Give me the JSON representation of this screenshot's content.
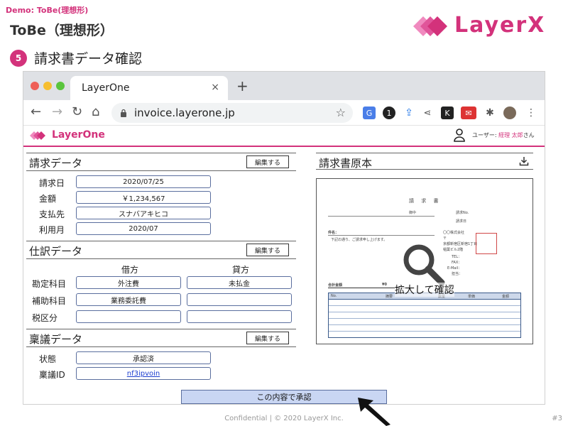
{
  "slide": {
    "demo_tag": "Demo: ToBe(理想形)",
    "title": "ToBe（理想形）",
    "logo_text": "LayerX",
    "step_number": "5",
    "step_title": "請求書データ確認",
    "footer": "Confidential | © 2020 LayerX Inc.",
    "page_number": "#3",
    "accent_color": "#d3327b"
  },
  "browser": {
    "tab_title": "LayerOne",
    "tab_close": "×",
    "new_tab": "+",
    "url": "invoice.layerone.jp",
    "nav": {
      "back": "←",
      "forward": "→",
      "reload": "↻",
      "home": "⌂"
    },
    "extensions": [
      "translate-icon",
      "1password-icon",
      "share-ext-icon",
      "share-icon",
      "k-icon",
      "gmail-badge-icon",
      "puzzle-icon",
      "avatar-icon",
      "menu-icon"
    ]
  },
  "app": {
    "name": "LayerOne",
    "user_label": "ユーザー: ",
    "user_name": "経理 太郎",
    "user_suffix": "さん"
  },
  "invoice_data": {
    "title": "請求データ",
    "edit_label": "編集する",
    "fields": [
      {
        "label": "請求日",
        "value": "2020/07/25"
      },
      {
        "label": "金額",
        "value": "￥1,234,567"
      },
      {
        "label": "支払先",
        "value": "スナバアキヒコ"
      },
      {
        "label": "利用月",
        "value": "2020/07"
      }
    ]
  },
  "journal": {
    "title": "仕訳データ",
    "edit_label": "編集する",
    "debit_header": "借方",
    "credit_header": "貸方",
    "rows": [
      {
        "label": "勘定科目",
        "debit": "外注費",
        "credit": "未払金"
      },
      {
        "label": "補助科目",
        "debit": "業務委託費",
        "credit": ""
      },
      {
        "label": "税区分",
        "debit": "",
        "credit": ""
      }
    ]
  },
  "approval": {
    "title": "稟議データ",
    "edit_label": "編集する",
    "fields": [
      {
        "label": "状態",
        "value": "承認済"
      },
      {
        "label": "稟議ID",
        "value": "nf3ipvoin"
      }
    ]
  },
  "original": {
    "title": "請求書原本",
    "zoom_label": "拡大して確認",
    "doc": {
      "heading": "請 求 書",
      "to_suffix": "御中",
      "invoice_no": "請求No.",
      "issue_date": "請求日",
      "subject_label": "件名：",
      "greeting": "下記の通り、ご請求申し上げます。",
      "company": "〇〇株式会社",
      "postal": "〒",
      "address1": "京都新宿区新宿1丁目",
      "address2": "稲葉ビル2階",
      "tel": "TEL：",
      "fax": "FAX：",
      "email": "E-Mail：",
      "contact": "担当：",
      "total_label": "合計金額",
      "total_value": "¥0",
      "table_headers": [
        "No.",
        "摘要",
        "数量",
        "単価",
        "金額"
      ]
    }
  },
  "approve_button": "この内容で承認"
}
